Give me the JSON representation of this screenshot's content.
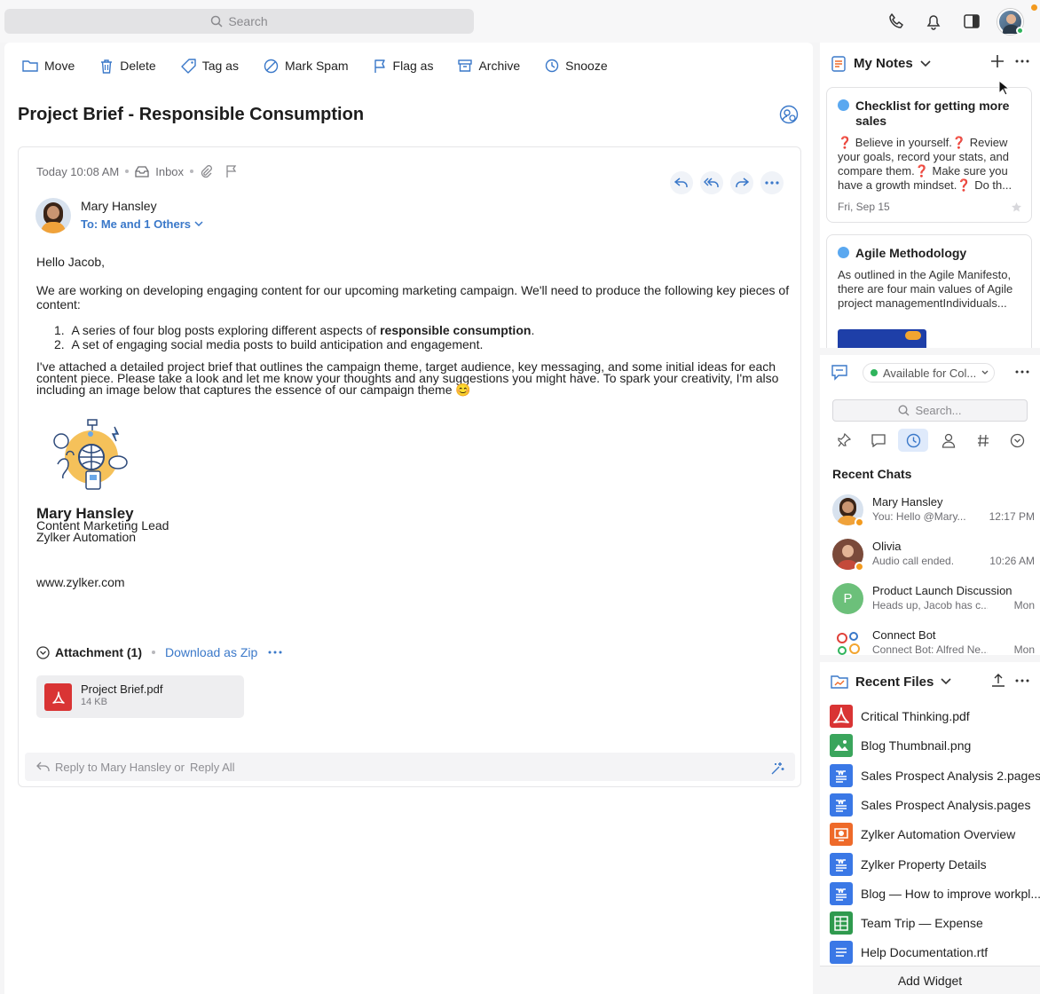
{
  "topbar": {
    "search_placeholder": "Search"
  },
  "toolbar": {
    "move": "Move",
    "delete": "Delete",
    "tag": "Tag as",
    "spam": "Mark Spam",
    "flag": "Flag as",
    "archive": "Archive",
    "snooze": "Snooze"
  },
  "email": {
    "subject": "Project Brief - Responsible Consumption",
    "time": "Today 10:08 AM",
    "folder": "Inbox",
    "sender": "Mary Hansley",
    "to": "To: Me and 1 Others",
    "greeting": "Hello Jacob,",
    "para1": "We are working on developing engaging content for our upcoming marketing campaign. We'll need to produce the following key pieces of content:",
    "list1_pre": "A series of four blog posts exploring different aspects of ",
    "list1_bold": "responsible consumption",
    "list1_post": ".",
    "list2": "A set of engaging social media posts to build anticipation and engagement.",
    "para2": "I've attached a detailed project brief that outlines the campaign theme, target audience, key messaging, and some initial ideas for each content piece. Please take a look and let me know your thoughts and any suggestions you might have. To spark your creativity, I'm also including an image below that captures the essence of our campaign theme 😊",
    "sig_name": "Mary Hansley",
    "sig_role": "Content Marketing Lead",
    "sig_company": "Zylker Automation",
    "sig_web": "www.zylker.com",
    "attachment_title": "Attachment (1)",
    "download_zip": "Download as Zip",
    "file_name": "Project Brief.pdf",
    "file_size": "14 KB",
    "reply_text": "Reply to Mary Hansley or",
    "reply_all": "Reply All"
  },
  "notes": {
    "title": "My Notes",
    "items": [
      {
        "title": "Checklist for getting more sales",
        "text": "❓ Believe in yourself.❓ Review your goals, record your stats, and compare them.❓ Make sure you have a growth mindset.❓ Do th...",
        "date": "Fri, Sep 15"
      },
      {
        "title": "Agile Methodology",
        "text": "As outlined in the Agile Manifesto, there are four main values of Agile project managementIndividuals..."
      }
    ]
  },
  "chat": {
    "status": "Available for Col...",
    "search_placeholder": "Search...",
    "recent_title": "Recent Chats",
    "items": [
      {
        "name": "Mary Hansley",
        "msg": "You: Hello @Mary...",
        "time": "12:17 PM"
      },
      {
        "name": "Olivia",
        "msg": "Audio call ended.",
        "time": "10:26 AM"
      },
      {
        "name": "Product Launch Discussion",
        "msg": "Heads up, Jacob has c...",
        "time": "Mon",
        "initial": "P"
      },
      {
        "name": "Connect Bot",
        "msg": "Connect Bot: Alfred Ne...",
        "time": "Mon"
      }
    ]
  },
  "files": {
    "title": "Recent Files",
    "items": [
      {
        "name": "Critical Thinking.pdf",
        "kind": "pdf",
        "color": "#d93434"
      },
      {
        "name": "Blog Thumbnail.png",
        "kind": "image",
        "color": "#3aa55c"
      },
      {
        "name": "Sales Prospect Analysis 2.pages",
        "kind": "doc",
        "color": "#3a78e6"
      },
      {
        "name": "Sales Prospect Analysis.pages",
        "kind": "doc",
        "color": "#3a78e6"
      },
      {
        "name": "Zylker Automation Overview",
        "kind": "slides",
        "color": "#ee6a2a"
      },
      {
        "name": "Zylker Property Details",
        "kind": "doc",
        "color": "#3a78e6"
      },
      {
        "name": "Blog — How to improve workpl...",
        "kind": "doc",
        "color": "#3a78e6"
      },
      {
        "name": "Team Trip — Expense",
        "kind": "sheet",
        "color": "#2f9a4e"
      },
      {
        "name": "Help Documentation.rtf",
        "kind": "text",
        "color": "#3a78e6"
      }
    ]
  },
  "add_widget": "Add Widget"
}
